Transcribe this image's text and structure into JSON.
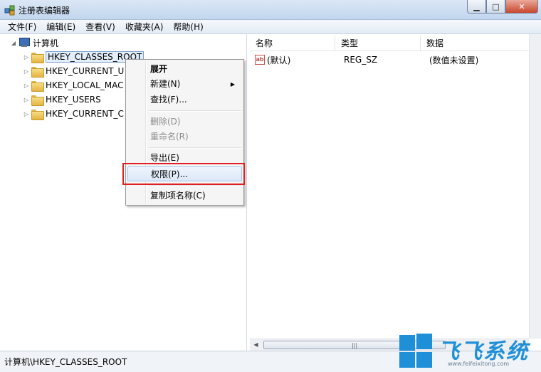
{
  "window": {
    "title": "注册表编辑器"
  },
  "menubar": [
    "文件(F)",
    "编辑(E)",
    "查看(V)",
    "收藏夹(A)",
    "帮助(H)"
  ],
  "tree": {
    "root": "计算机",
    "keys": [
      "HKEY_CLASSES_ROOT",
      "HKEY_CURRENT_U",
      "HKEY_LOCAL_MAC",
      "HKEY_USERS",
      "HKEY_CURRENT_C"
    ]
  },
  "list": {
    "columns": [
      "名称",
      "类型",
      "数据"
    ],
    "rows": [
      {
        "name": "(默认)",
        "type": "REG_SZ",
        "data": "(数值未设置)"
      }
    ]
  },
  "context_menu": {
    "expand": "展开",
    "new": "新建(N)",
    "find": "查找(F)...",
    "delete": "删除(D)",
    "rename": "重命名(R)",
    "export": "导出(E)",
    "permissions": "权限(P)...",
    "copy_key_name": "复制项名称(C)"
  },
  "status": {
    "path": "计算机\\HKEY_CLASSES_ROOT"
  },
  "watermark": {
    "text": "飞飞系统",
    "url": "www.feifeixitong.com"
  }
}
